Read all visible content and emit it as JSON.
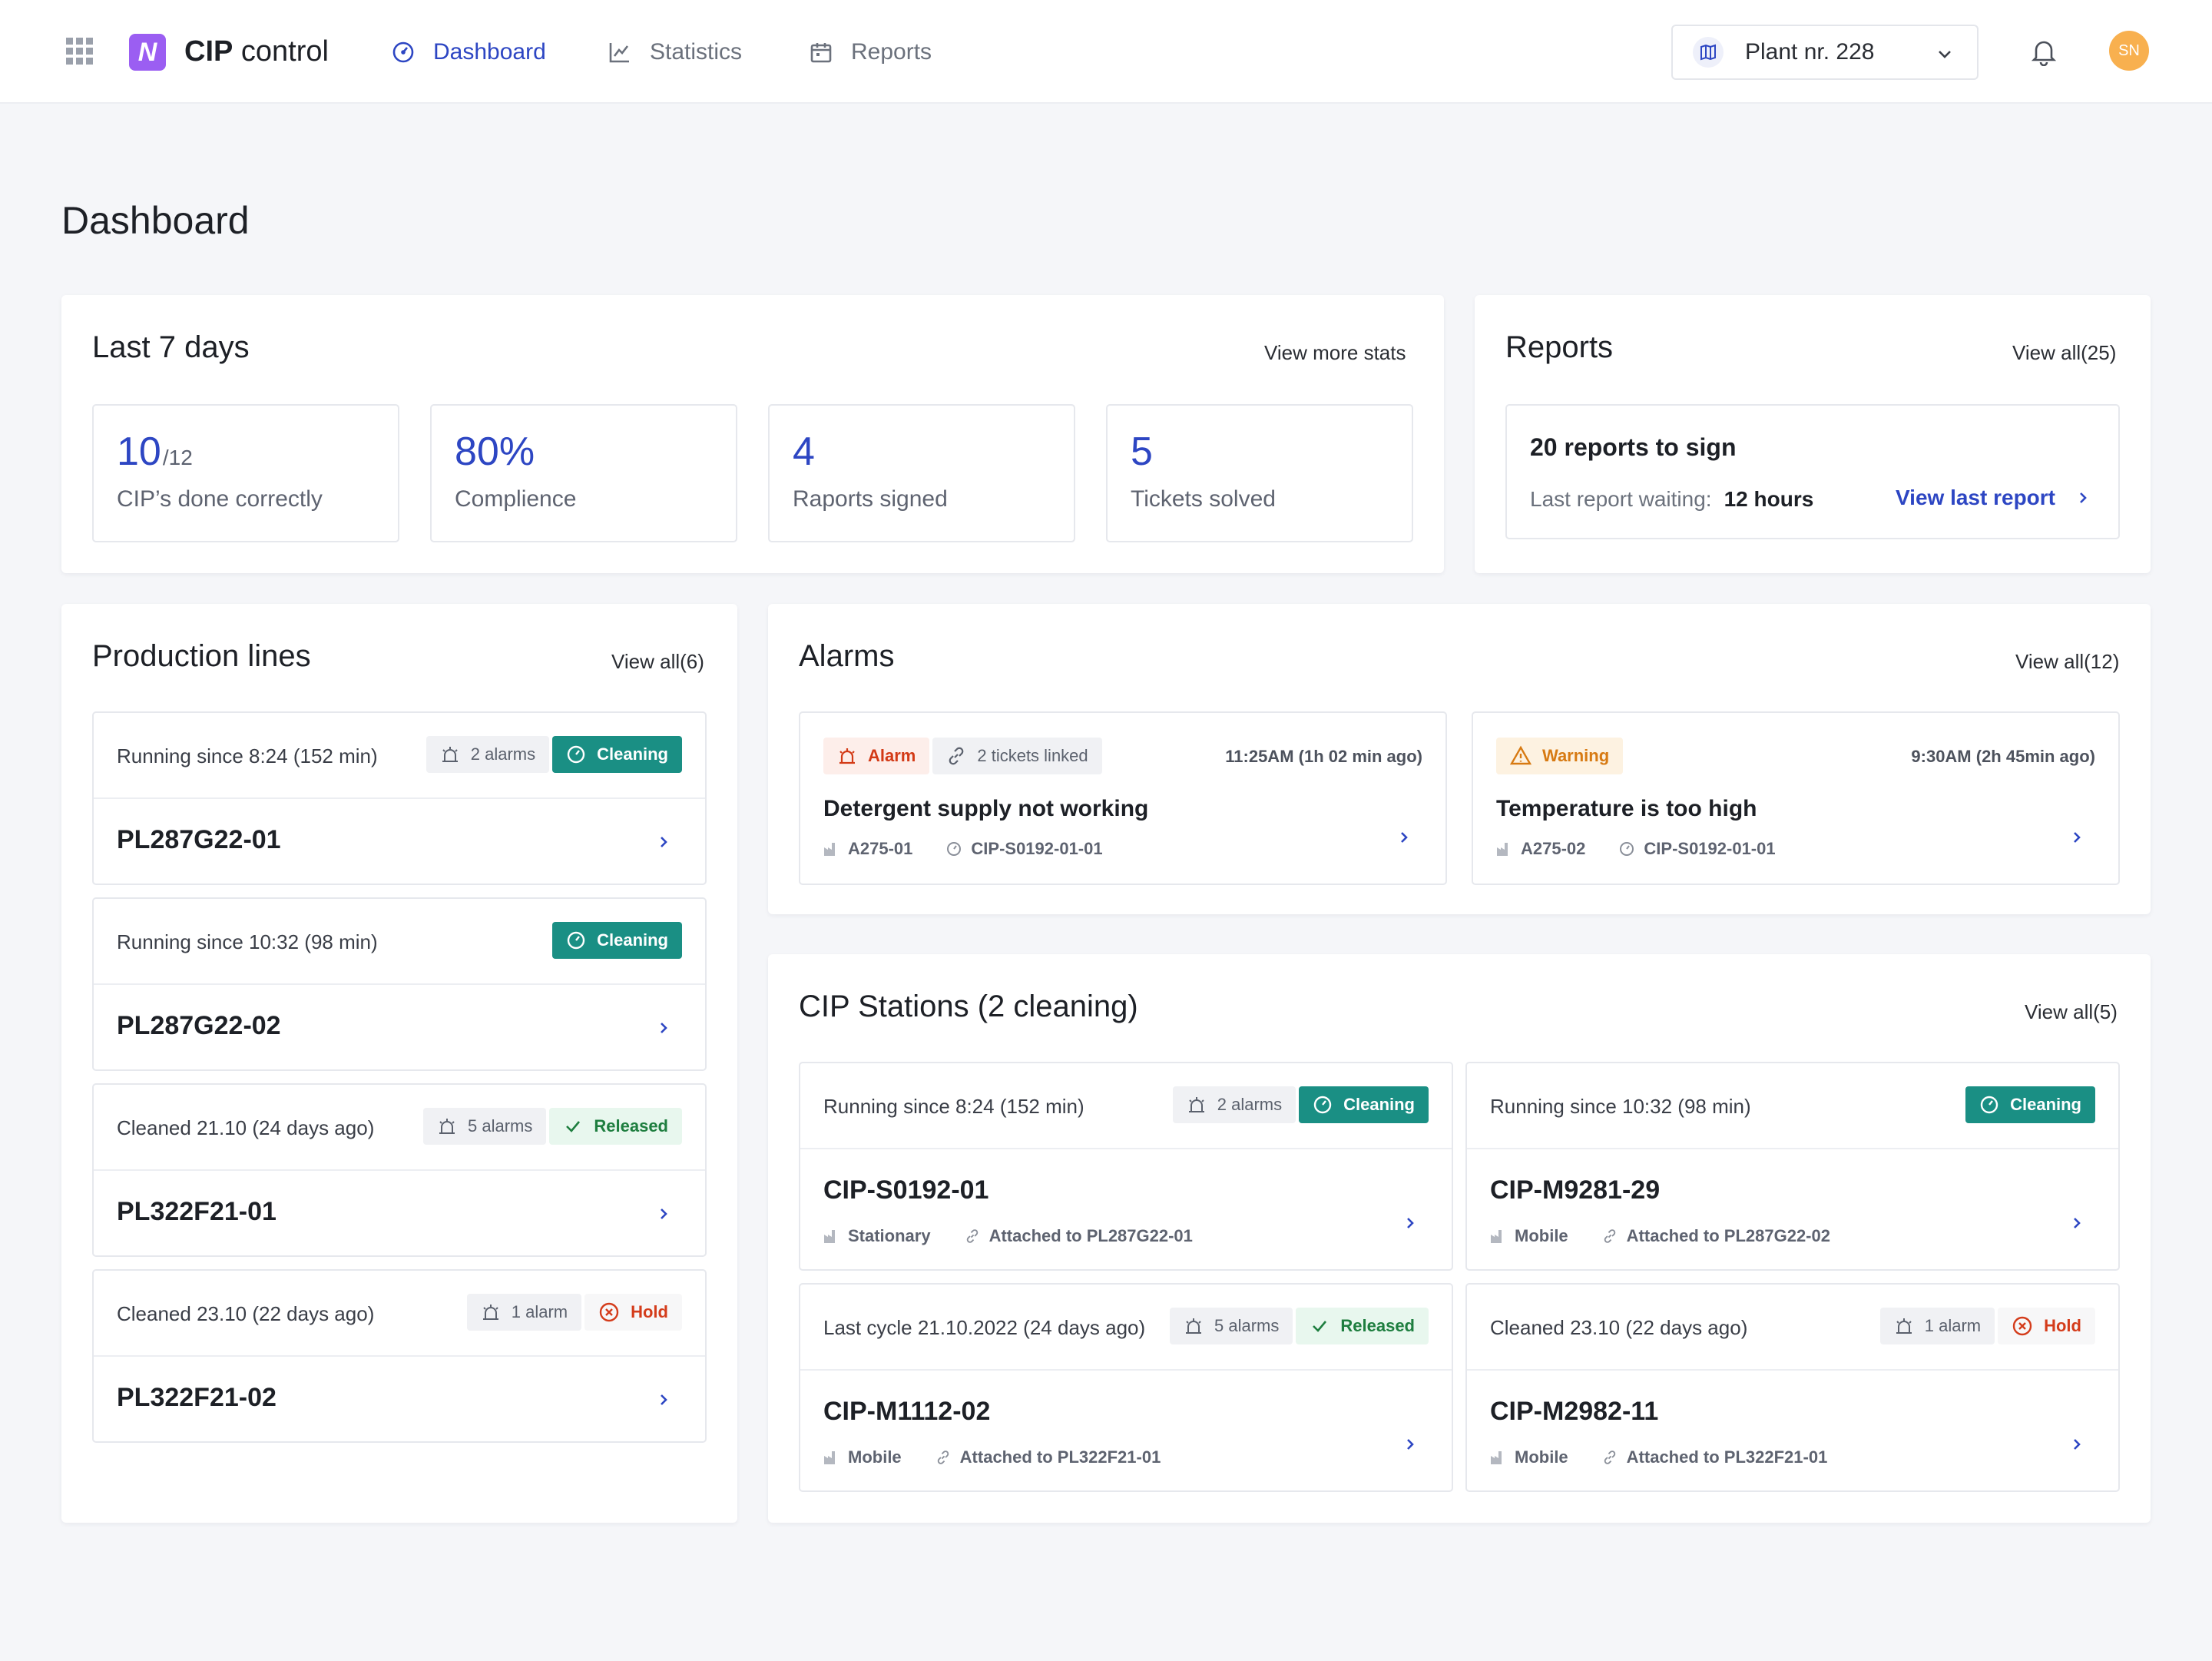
{
  "app": {
    "title_bold": "CIP",
    "title_rest": " control",
    "logo_letter": "N",
    "brand_color": "#9b5ef2"
  },
  "nav": {
    "dashboard": "Dashboard",
    "statistics": "Statistics",
    "reports": "Reports"
  },
  "plant_select": {
    "value": "Plant nr. 228"
  },
  "user": {
    "initials": "SN"
  },
  "page": {
    "title": "Dashboard"
  },
  "last7": {
    "title": "Last 7 days",
    "link": "View more stats",
    "stats": [
      {
        "value": "10",
        "suffix": "/12",
        "label": "CIP’s done correctly"
      },
      {
        "value": "80%",
        "label": "Complience"
      },
      {
        "value": "4",
        "label": "Raports signed"
      },
      {
        "value": "5",
        "label": "Tickets solved"
      }
    ]
  },
  "reports": {
    "title": "Reports",
    "link": "View all(25)",
    "to_sign": "20 reports to sign",
    "waiting_label": "Last report waiting:",
    "waiting_value": "12 hours",
    "view_last": "View last report"
  },
  "production": {
    "title": "Production lines",
    "link": "View all(6)",
    "lines": [
      {
        "status": "Running since 8:24 (152 min)",
        "alarms": "2 alarms",
        "state": "Cleaning",
        "name": "PL287G22-01"
      },
      {
        "status": "Running since 10:32 (98 min)",
        "state": "Cleaning",
        "name": "PL287G22-02"
      },
      {
        "status": "Cleaned 21.10 (24 days ago)",
        "alarms": "5 alarms",
        "state": "Released",
        "name": "PL322F21-01"
      },
      {
        "status": "Cleaned 23.10 (22 days ago)",
        "alarms": "1 alarm",
        "state": "Hold",
        "name": "PL322F21-02"
      }
    ]
  },
  "alarms": {
    "title": "Alarms",
    "link": "View all(12)",
    "items": [
      {
        "type": "Alarm",
        "tickets": "2 tickets linked",
        "time": "11:25AM (1h 02 min ago)",
        "title": "Detergent supply not working",
        "line": "A275-01",
        "station": "CIP-S0192-01-01"
      },
      {
        "type": "Warning",
        "time": "9:30AM (2h 45min ago)",
        "title": "Temperature is too high",
        "line": "A275-02",
        "station": "CIP-S0192-01-01"
      }
    ]
  },
  "stations": {
    "title": "CIP Stations (2 cleaning)",
    "link": "View all(5)",
    "items": [
      {
        "status": "Running since 8:24 (152 min)",
        "alarms": "2 alarms",
        "state": "Cleaning",
        "name": "CIP-S0192-01",
        "kind": "Stationary",
        "attached": "Attached to PL287G22-01"
      },
      {
        "status": "Running since 10:32 (98 min)",
        "state": "Cleaning",
        "name": "CIP-M9281-29",
        "kind": "Mobile",
        "attached": "Attached to PL287G22-02"
      },
      {
        "status": "Last cycle 21.10.2022 (24 days ago)",
        "alarms": "5 alarms",
        "state": "Released",
        "name": "CIP-M1112-02",
        "kind": "Mobile",
        "attached": "Attached to PL322F21-01"
      },
      {
        "status": "Cleaned 23.10 (22 days ago)",
        "alarms": "1 alarm",
        "state": "Hold",
        "name": "CIP-M2982-11",
        "kind": "Mobile",
        "attached": "Attached to PL322F21-01"
      }
    ]
  },
  "colors": {
    "primary": "#2d46c3",
    "teal": "#1a8f84",
    "alarm": "#d33a16",
    "warning": "#d77a12",
    "released": "#1e7e3f",
    "avatar": "#f8b04f"
  }
}
